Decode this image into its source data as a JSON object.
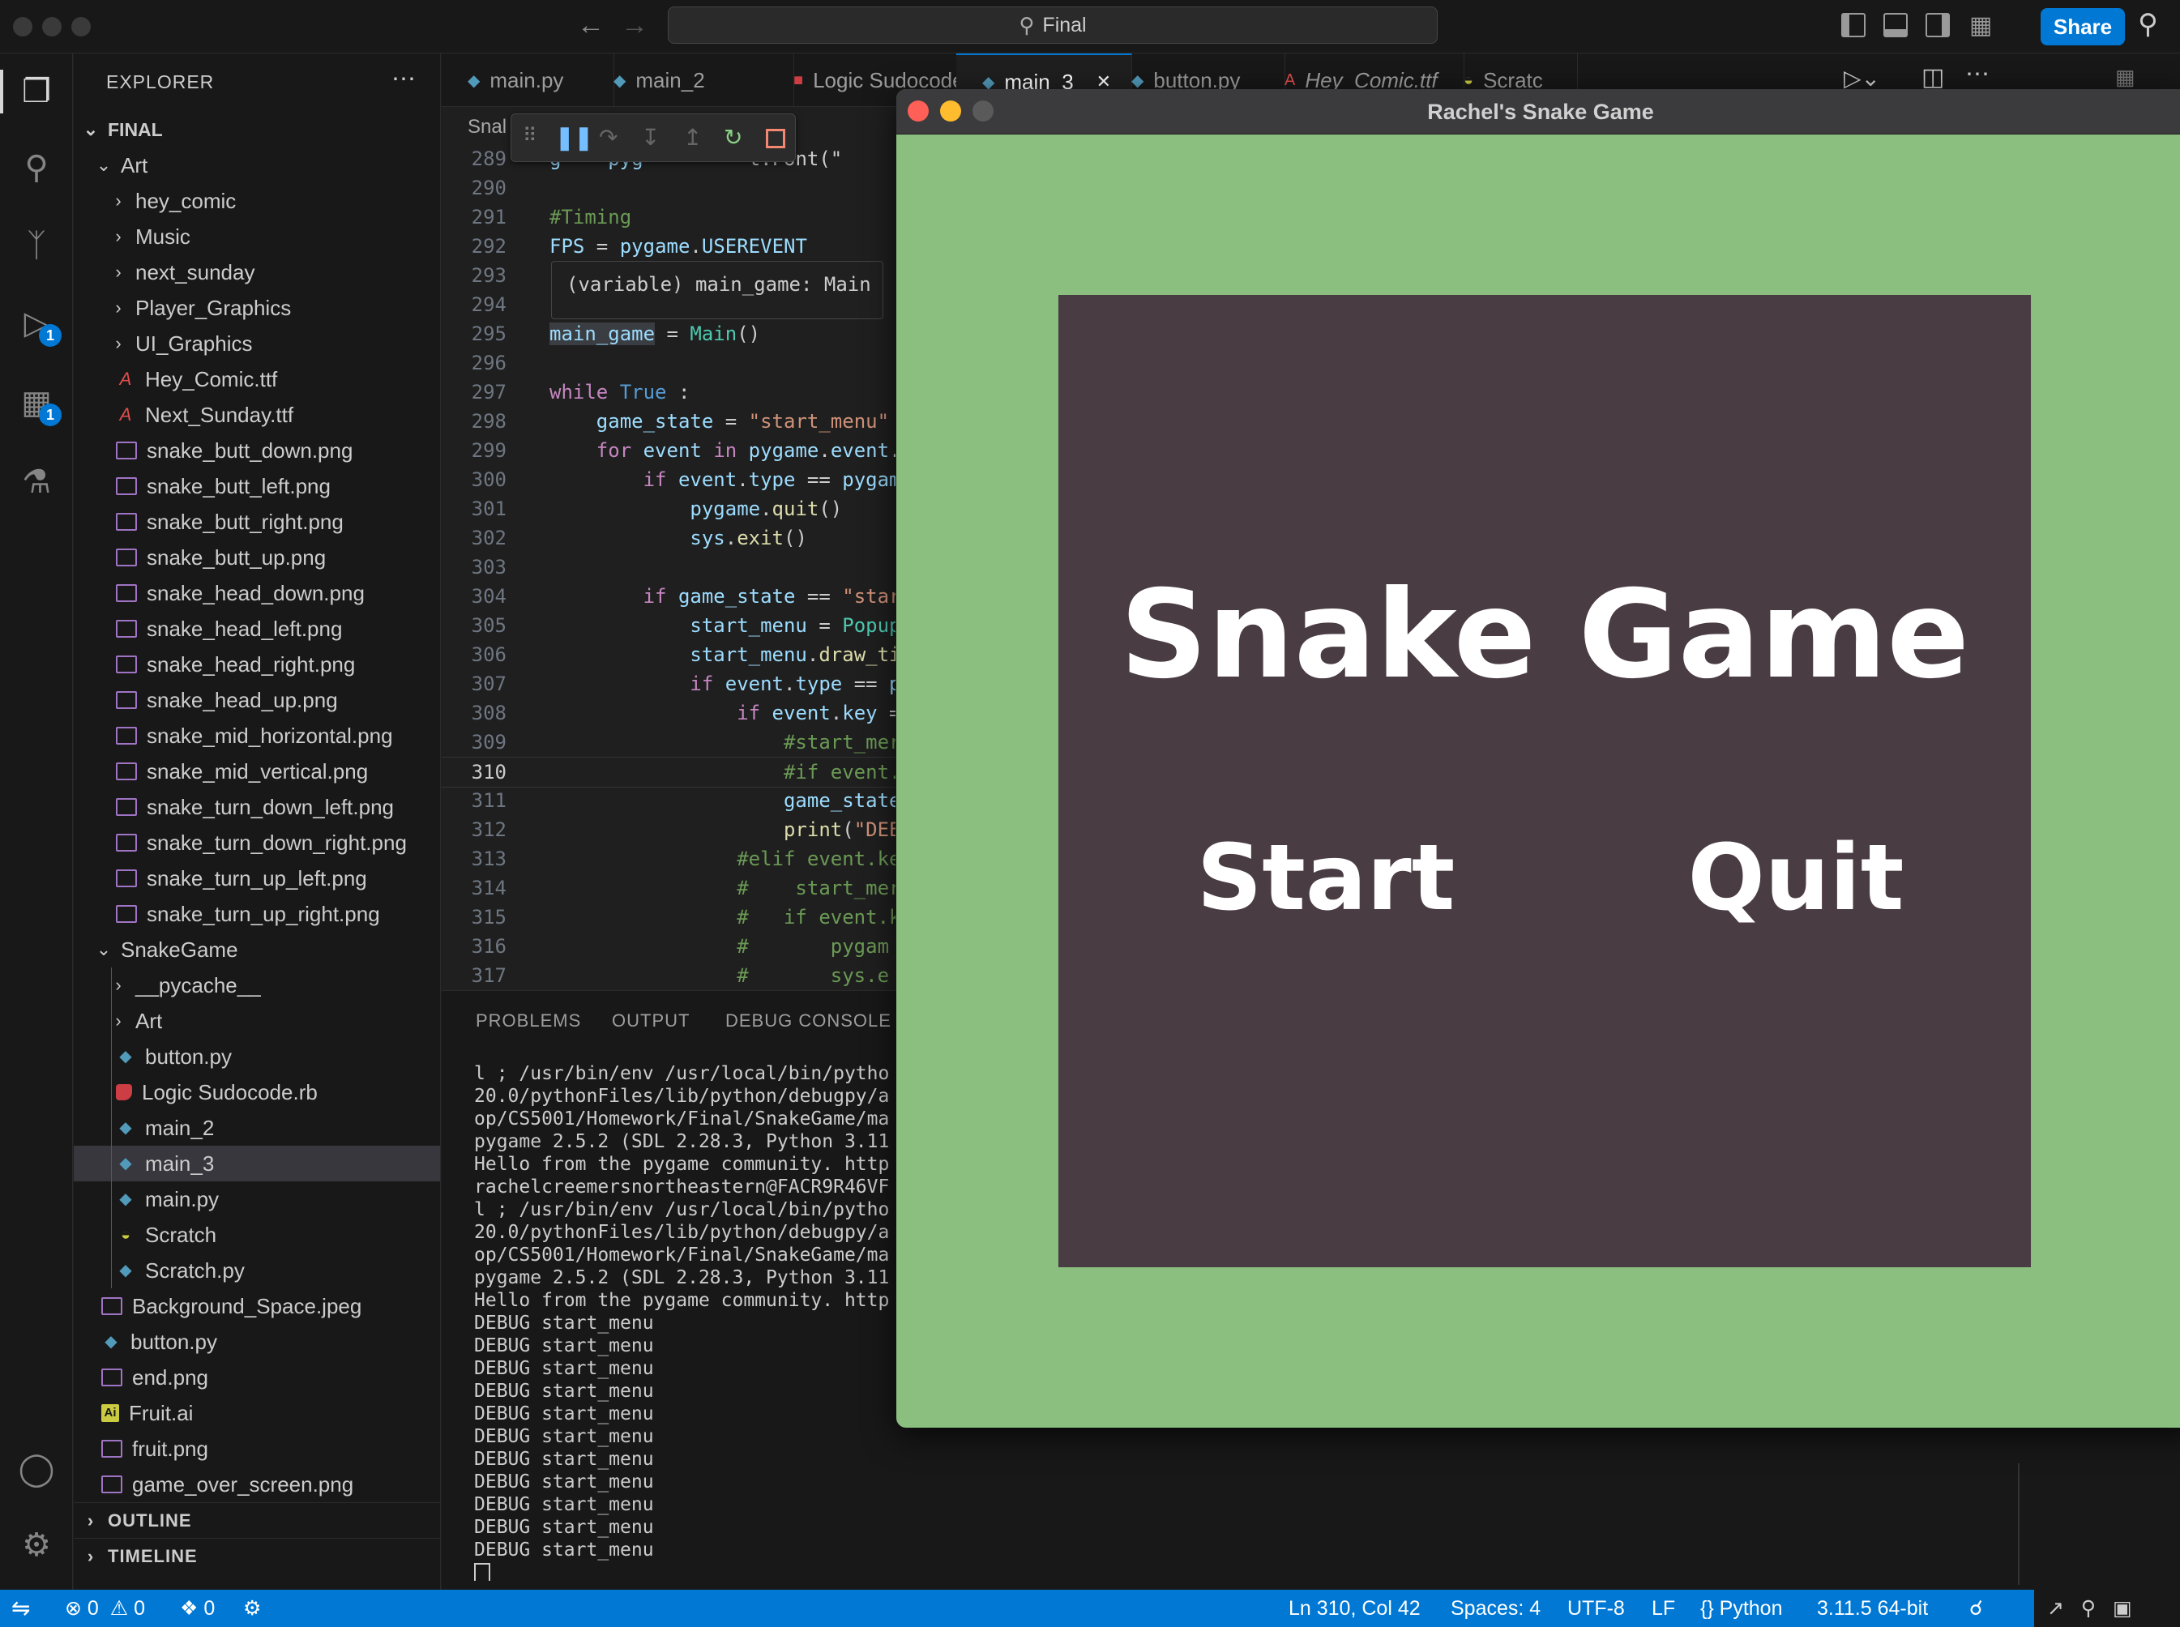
{
  "titlebar": {
    "search_text": "Final",
    "share_label": "Share"
  },
  "explorer": {
    "title": "EXPLORER",
    "root": "FINAL",
    "items": [
      {
        "label": "Art",
        "type": "folder-open",
        "depth": 1
      },
      {
        "label": "hey_comic",
        "type": "folder",
        "depth": 2
      },
      {
        "label": "Music",
        "type": "folder",
        "depth": 2
      },
      {
        "label": "next_sunday",
        "type": "folder",
        "depth": 2
      },
      {
        "label": "Player_Graphics",
        "type": "folder",
        "depth": 2
      },
      {
        "label": "UI_Graphics",
        "type": "folder",
        "depth": 2
      },
      {
        "label": "Hey_Comic.ttf",
        "type": "ttf",
        "depth": 2
      },
      {
        "label": "Next_Sunday.ttf",
        "type": "ttf",
        "depth": 2
      },
      {
        "label": "snake_butt_down.png",
        "type": "img",
        "depth": 2
      },
      {
        "label": "snake_butt_left.png",
        "type": "img",
        "depth": 2
      },
      {
        "label": "snake_butt_right.png",
        "type": "img",
        "depth": 2
      },
      {
        "label": "snake_butt_up.png",
        "type": "img",
        "depth": 2
      },
      {
        "label": "snake_head_down.png",
        "type": "img",
        "depth": 2
      },
      {
        "label": "snake_head_left.png",
        "type": "img",
        "depth": 2
      },
      {
        "label": "snake_head_right.png",
        "type": "img",
        "depth": 2
      },
      {
        "label": "snake_head_up.png",
        "type": "img",
        "depth": 2
      },
      {
        "label": "snake_mid_horizontal.png",
        "type": "img",
        "depth": 2
      },
      {
        "label": "snake_mid_vertical.png",
        "type": "img",
        "depth": 2
      },
      {
        "label": "snake_turn_down_left.png",
        "type": "img",
        "depth": 2
      },
      {
        "label": "snake_turn_down_right.png",
        "type": "img",
        "depth": 2
      },
      {
        "label": "snake_turn_up_left.png",
        "type": "img",
        "depth": 2
      },
      {
        "label": "snake_turn_up_right.png",
        "type": "img",
        "depth": 2
      },
      {
        "label": "SnakeGame",
        "type": "folder-open",
        "depth": 1
      },
      {
        "label": "__pycache__",
        "type": "folder",
        "depth": 2
      },
      {
        "label": "Art",
        "type": "folder",
        "depth": 2
      },
      {
        "label": "button.py",
        "type": "py",
        "depth": 2
      },
      {
        "label": "Logic Sudocode.rb",
        "type": "rb",
        "depth": 2
      },
      {
        "label": "main_2",
        "type": "py",
        "depth": 2
      },
      {
        "label": "main_3",
        "type": "py",
        "depth": 2,
        "selected": true
      },
      {
        "label": "main.py",
        "type": "py",
        "depth": 2
      },
      {
        "label": "Scratch",
        "type": "scratch",
        "depth": 2
      },
      {
        "label": "Scratch.py",
        "type": "py",
        "depth": 2
      },
      {
        "label": "Background_Space.jpeg",
        "type": "img",
        "depth": 1
      },
      {
        "label": "button.py",
        "type": "py",
        "depth": 1
      },
      {
        "label": "end.png",
        "type": "img",
        "depth": 1
      },
      {
        "label": "Fruit.ai",
        "type": "ai",
        "depth": 1
      },
      {
        "label": "fruit.png",
        "type": "img",
        "depth": 1
      },
      {
        "label": "game_over_screen.png",
        "type": "img",
        "depth": 1
      }
    ],
    "outline_label": "OUTLINE",
    "timeline_label": "TIMELINE"
  },
  "tabs": [
    {
      "label": "main.py",
      "icon": "py"
    },
    {
      "label": "main_2",
      "icon": "py"
    },
    {
      "label": "Logic Sudocode.rb",
      "icon": "rb"
    },
    {
      "label": "main_3",
      "icon": "py",
      "active": true
    },
    {
      "label": "button.py",
      "icon": "py"
    },
    {
      "label": "Hey_Comic.ttf",
      "icon": "ttf"
    },
    {
      "label": "Scratc",
      "icon": "scratch"
    }
  ],
  "breadcrumb": "Snal",
  "hover_text": "(variable) main_game: Main",
  "current_line": 310,
  "code_lines": [
    {
      "n": 289,
      "html": "<span class='var'>g</span><span>    </span><span class='var'>pyg</span>         <span>t.Font(\"</span>"
    },
    {
      "n": 290,
      "html": ""
    },
    {
      "n": 291,
      "html": "<span class='cm'>#Timing</span>"
    },
    {
      "n": 292,
      "html": "<span class='var'>FPS</span> = <span class='var'>pygame</span>.<span class='var'>USEREVENT</span>"
    },
    {
      "n": 293,
      "html": ""
    },
    {
      "n": 294,
      "html": ""
    },
    {
      "n": 295,
      "html": "<span class='var' style='background:#3a3d41'>main_game</span> = <span class='cls'>Main</span>()"
    },
    {
      "n": 296,
      "html": ""
    },
    {
      "n": 297,
      "html": "<span class='kw'>while</span> <span class='kb'>True</span> :"
    },
    {
      "n": 298,
      "html": "    <span class='var'>game_state</span> = <span class='str'>\"start_menu\"</span>"
    },
    {
      "n": 299,
      "html": "    <span class='kw'>for</span> <span class='var'>event</span> <span class='kw'>in</span> <span class='var'>pygame</span>.<span class='var'>event</span>."
    },
    {
      "n": 300,
      "html": "        <span class='kw'>if</span> <span class='var'>event</span>.<span class='var'>type</span> == <span class='var'>pygam</span>"
    },
    {
      "n": 301,
      "html": "            <span class='var'>pygame</span>.<span class='fn'>quit</span>()"
    },
    {
      "n": 302,
      "html": "            <span class='var'>sys</span>.<span class='fn'>exit</span>()"
    },
    {
      "n": 303,
      "html": ""
    },
    {
      "n": 304,
      "html": "        <span class='kw'>if</span> <span class='var'>game_state</span> == <span class='str'>\"star</span>"
    },
    {
      "n": 305,
      "html": "            <span class='var'>start_menu</span> = <span class='cls'>Popup</span>"
    },
    {
      "n": 306,
      "html": "            <span class='var'>start_menu</span>.<span class='fn'>draw_ti</span>"
    },
    {
      "n": 307,
      "html": "            <span class='kw'>if</span> <span class='var'>event</span>.<span class='var'>type</span> == <span class='var'>p</span>"
    },
    {
      "n": 308,
      "html": "                <span class='kw'>if</span> <span class='var'>event</span>.<span class='var'>key</span> ="
    },
    {
      "n": 309,
      "html": "                    <span class='cm'>#start_mer</span>"
    },
    {
      "n": 310,
      "html": "                    <span class='cm'>#if event.</span>"
    },
    {
      "n": 311,
      "html": "                    <span class='var'>game_state</span>"
    },
    {
      "n": 312,
      "html": "                    <span class='fn'>print</span>(<span class='str'>\"DEE</span>"
    },
    {
      "n": 313,
      "html": "                <span class='cm'>#elif event.ke</span>"
    },
    {
      "n": 314,
      "html": "                <span class='cm'>#    start_mer</span>"
    },
    {
      "n": 315,
      "html": "                <span class='cm'>#   if event.k</span>"
    },
    {
      "n": 316,
      "html": "                <span class='cm'>#       pygam</span>"
    },
    {
      "n": 317,
      "html": "                <span class='cm'>#       sys.e</span>"
    }
  ],
  "panel": {
    "tabs": [
      "PROBLEMS",
      "OUTPUT",
      "DEBUG CONSOLE"
    ],
    "terminal_lines": [
      "l ; /usr/bin/env /usr/local/bin/pytho",
      "20.0/pythonFiles/lib/python/debugpy/a",
      "op/CS5001/Homework/Final/SnakeGame/ma",
      "pygame 2.5.2 (SDL 2.28.3, Python 3.11",
      "Hello from the pygame community. http",
      "rachelcreemersnortheastern@FACR9R46VF",
      "l ; /usr/bin/env /usr/local/bin/pytho",
      "20.0/pythonFiles/lib/python/debugpy/a",
      "op/CS5001/Homework/Final/SnakeGame/ma",
      "pygame 2.5.2 (SDL 2.28.3, Python 3.11",
      "Hello from the pygame community. http",
      "DEBUG start_menu",
      "DEBUG start_menu",
      "DEBUG start_menu",
      "DEBUG start_menu",
      "DEBUG start_menu",
      "DEBUG start_menu",
      "DEBUG start_menu",
      "DEBUG start_menu",
      "DEBUG start_menu",
      "DEBUG start_menu",
      "DEBUG start_menu"
    ]
  },
  "statusbar": {
    "errors": "0",
    "warnings": "0",
    "ports": "0",
    "position": "Ln 310, Col 42",
    "spaces": "Spaces: 4",
    "encoding": "UTF-8",
    "eol": "LF",
    "language": "Python",
    "interpreter": "3.11.5 64-bit"
  },
  "game": {
    "window_title": "Rachel's Snake Game",
    "heading": "Snake Game",
    "start_label": "Start",
    "quit_label": "Quit",
    "colors": {
      "background": "#8bbf80",
      "panel": "#4a3c43",
      "text": "#ffffff"
    }
  }
}
